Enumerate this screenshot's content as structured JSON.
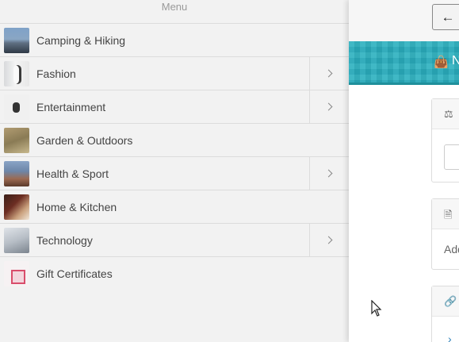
{
  "menu": {
    "header": "Menu",
    "items": [
      {
        "label": "Camping & Hiking",
        "thumb": "camping-thumbnail",
        "has_submenu": false
      },
      {
        "label": "Fashion",
        "thumb": "fashion-thumbnail",
        "has_submenu": true
      },
      {
        "label": "Entertainment",
        "thumb": "entertainment-thumbnail",
        "has_submenu": true
      },
      {
        "label": "Garden & Outdoors",
        "thumb": "garden-thumbnail",
        "has_submenu": false
      },
      {
        "label": "Health & Sport",
        "thumb": "health-thumbnail",
        "has_submenu": true
      },
      {
        "label": "Home & Kitchen",
        "thumb": "home-thumbnail",
        "has_submenu": false
      },
      {
        "label": "Technology",
        "thumb": "technology-thumbnail",
        "has_submenu": true
      },
      {
        "label": "Gift Certificates",
        "thumb": "gift-thumbnail",
        "has_submenu": false
      }
    ]
  },
  "right_panel": {
    "back_icon": "arrow-left-icon",
    "band_icon": "shopping-bag-icon",
    "band_text": "N",
    "card1_icon": "scales-icon",
    "card2_icon": "document-icon",
    "card2_text": "Add",
    "card3_icon": "link-icon",
    "card3_link": "›"
  },
  "colors": {
    "accent": "#2bb0bf",
    "menu_bg": "#f2f2f2",
    "divider": "#dcdcdc"
  }
}
